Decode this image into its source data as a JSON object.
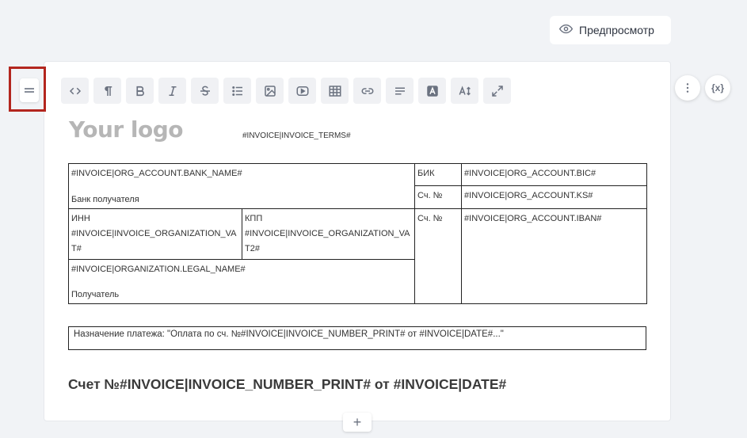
{
  "header": {
    "preview_label": "Предпросмотр",
    "preview_icon": "eye-icon"
  },
  "toolbar": {
    "buttons": [
      {
        "icon": "code-icon"
      },
      {
        "icon": "paragraph-icon"
      },
      {
        "icon": "bold-icon"
      },
      {
        "icon": "italic-icon"
      },
      {
        "icon": "strikethrough-icon"
      },
      {
        "icon": "list-icon"
      },
      {
        "icon": "image-icon"
      },
      {
        "icon": "video-icon"
      },
      {
        "icon": "table-icon"
      },
      {
        "icon": "link-icon"
      },
      {
        "icon": "align-icon"
      },
      {
        "icon": "text-color-icon"
      },
      {
        "icon": "font-size-icon"
      },
      {
        "icon": "fullscreen-icon"
      }
    ]
  },
  "side": {
    "variables_label": "{x}"
  },
  "document": {
    "logo": "Your logo",
    "terms": "#INVOICE|INVOICE_TERMS#",
    "bank": {
      "bank_name": "#INVOICE|ORG_ACCOUNT.BANK_NAME#",
      "bank_label": "Банк получателя",
      "bik_label": "БИК",
      "bik_value": "#INVOICE|ORG_ACCOUNT.BIC#",
      "ks_label": "Сч. №",
      "ks_value": "#INVOICE|ORG_ACCOUNT.KS#",
      "inn_label": "ИНН",
      "inn_value": "#INVOICE|INVOICE_ORGANIZATION_VAT#",
      "kpp_label": "КПП",
      "kpp_value": "#INVOICE|INVOICE_ORGANIZATION_VAT2#",
      "iban_label": "Сч. №",
      "iban_value": "#INVOICE|ORG_ACCOUNT.IBAN#",
      "legal_name": "#INVOICE|ORGANIZATION.LEGAL_NAME#",
      "recipient_label": "Получатель"
    },
    "purpose": "Назначение платежа: \"Оплата по сч. №#INVOICE|INVOICE_NUMBER_PRINT# от #INVOICE|DATE#...\"",
    "title": "Счет №#INVOICE|INVOICE_NUMBER_PRINT# от #INVOICE|DATE#"
  },
  "footer": {
    "add_label": "+"
  }
}
